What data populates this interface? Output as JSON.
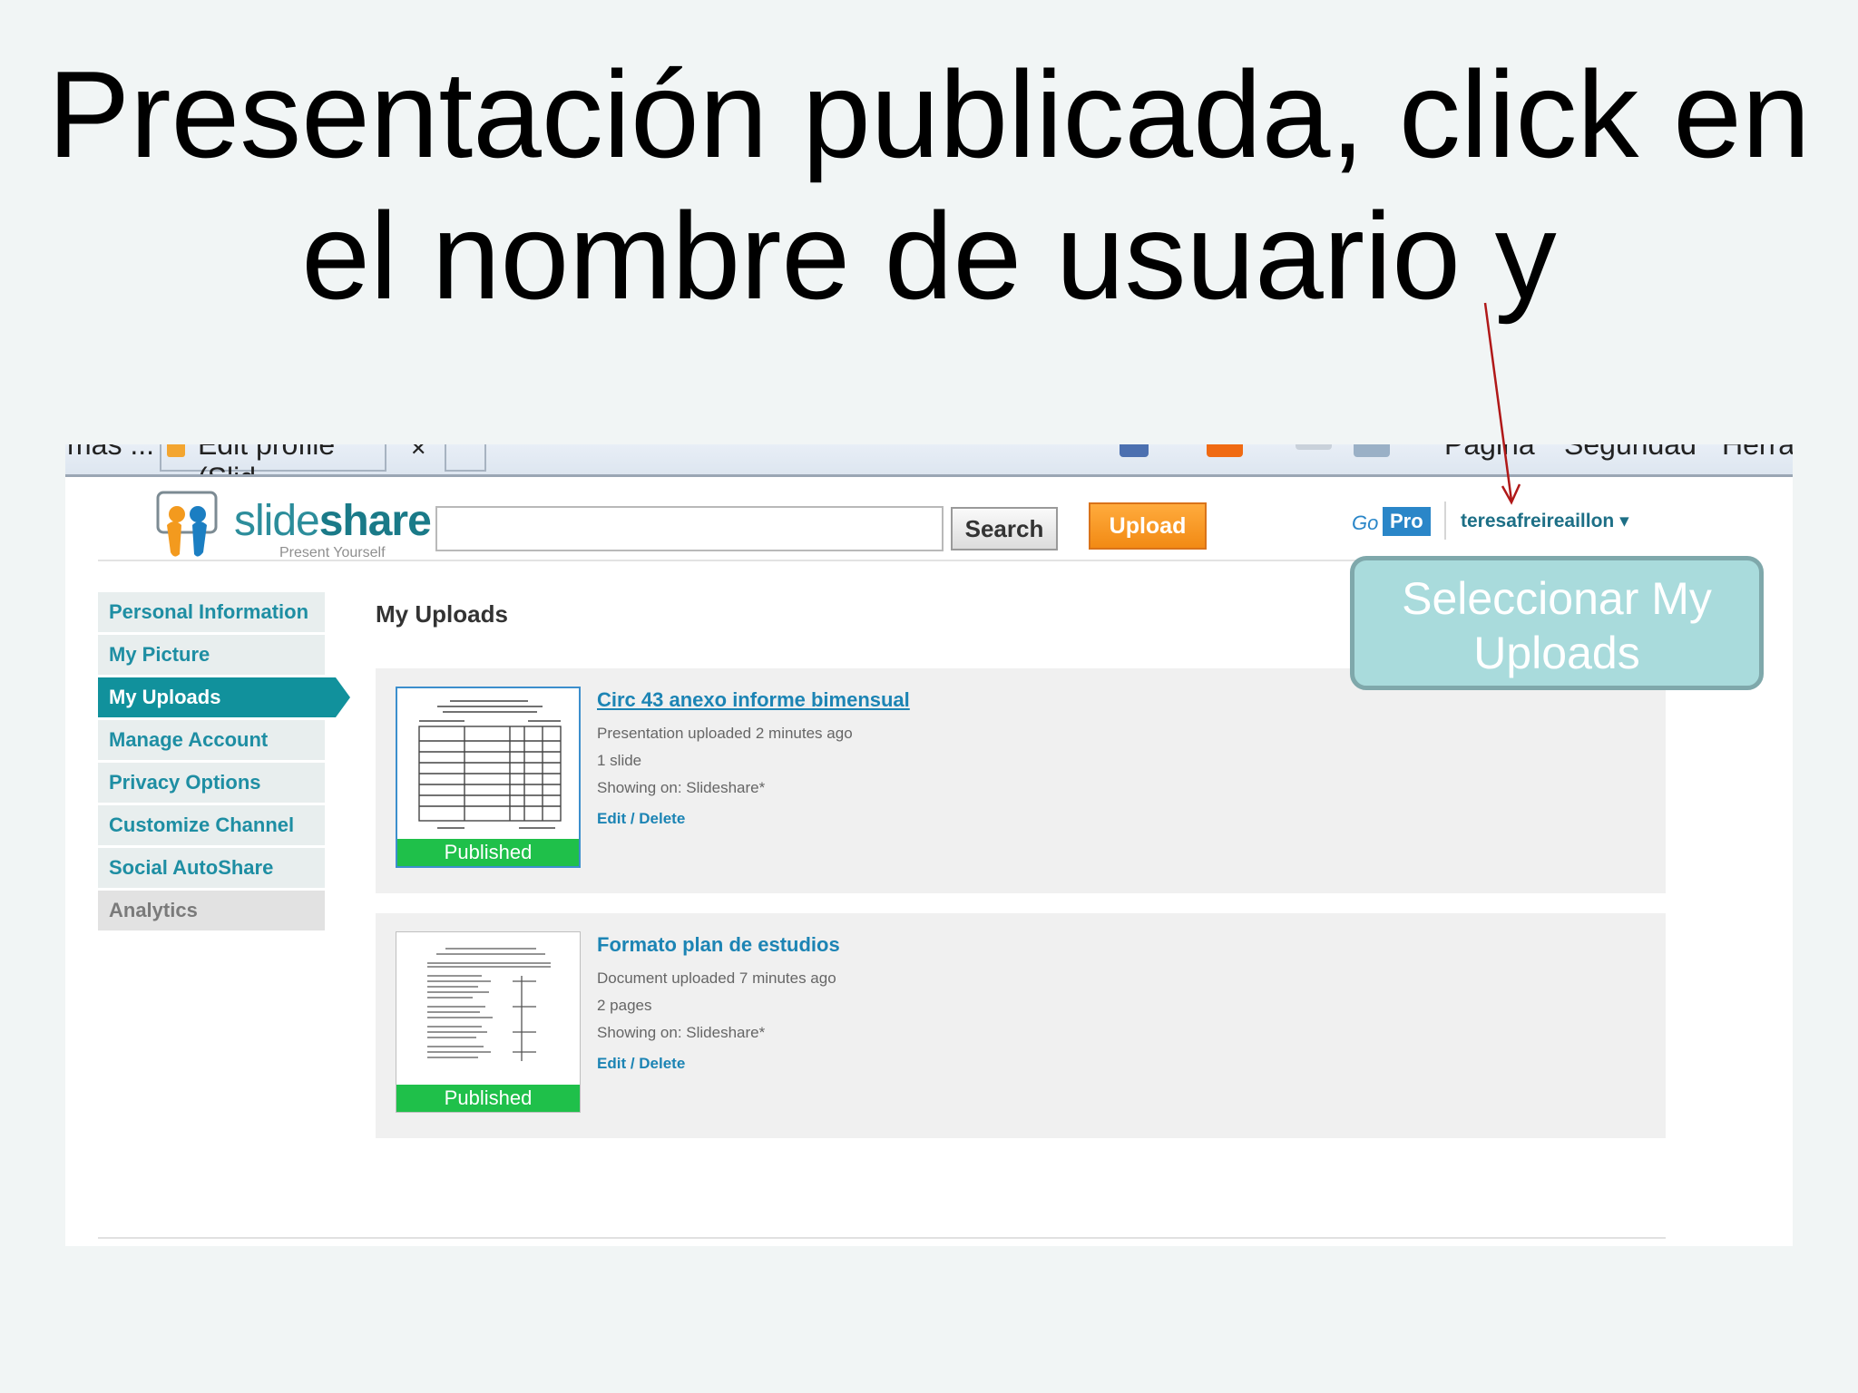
{
  "slide": {
    "title_line1": "Presentación publicada, click en",
    "title_line2": "el nombre de usuario y"
  },
  "browser": {
    "tab_left": "más ...",
    "tab_active": "Edit profile (Slid...",
    "tab_close": "✕",
    "menu_page": "Página",
    "menu_security": "Seguridad",
    "menu_tools": "Herra..."
  },
  "header": {
    "logo_word_light": "slide",
    "logo_word_bold": "share",
    "tagline": "Present Yourself",
    "search_placeholder": "",
    "search_label": "Search",
    "upload_label": "Upload",
    "go_label": "Go",
    "pro_label": "Pro",
    "username": "teresafreireaillon ▾"
  },
  "callout": {
    "text": "Seleccionar My Uploads"
  },
  "sidebar": {
    "items": [
      {
        "label": "Personal Information"
      },
      {
        "label": "My Picture"
      },
      {
        "label": "My Uploads"
      },
      {
        "label": "Manage Account"
      },
      {
        "label": "Privacy Options"
      },
      {
        "label": "Customize Channel"
      },
      {
        "label": "Social AutoShare"
      },
      {
        "label": "Analytics"
      }
    ]
  },
  "main": {
    "section_title": "My Uploads",
    "uploads": [
      {
        "title": "Circ 43 anexo informe bimensual",
        "uploaded": "Presentation uploaded 2 minutes ago",
        "count": "1 slide",
        "showing": "Showing on: Slideshare*",
        "edit": "Edit / Delete",
        "status": "Published"
      },
      {
        "title": "Formato plan de estudios",
        "uploaded": "Document uploaded 7 minutes ago",
        "count": "2 pages",
        "showing": "Showing on: Slideshare*",
        "edit": "Edit / Delete",
        "status": "Published"
      }
    ]
  },
  "colors": {
    "accent": "#11919c",
    "link": "#1c84b4",
    "published": "#1fc04a",
    "upload": "#f28a14",
    "callout": "#a9dbdc",
    "arrow": "#b01818"
  }
}
